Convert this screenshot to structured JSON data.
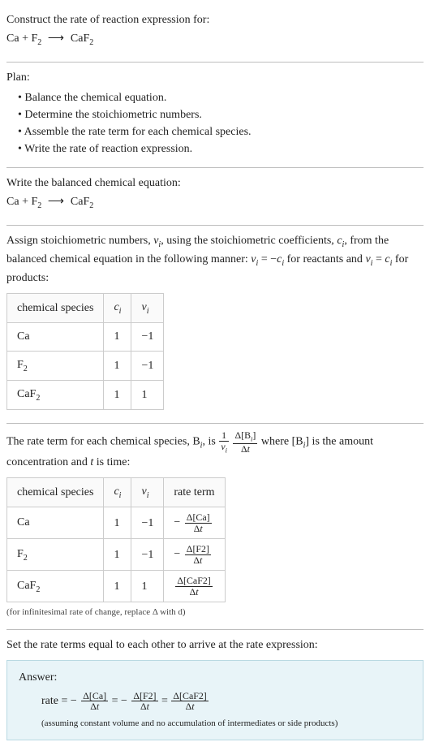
{
  "intro": {
    "prompt": "Construct the rate of reaction expression for:"
  },
  "equation": {
    "r1": "Ca",
    "plus": " + ",
    "r2a": "F",
    "r2s": "2",
    "arrow": "⟶",
    "p1a": "CaF",
    "p1s": "2"
  },
  "plan": {
    "heading": "Plan:",
    "items": [
      "Balance the chemical equation.",
      "Determine the stoichiometric numbers.",
      "Assemble the rate term for each chemical species.",
      "Write the rate of reaction expression."
    ]
  },
  "balanced_heading": "Write the balanced chemical equation:",
  "stoich_text": {
    "p1": "Assign stoichiometric numbers, ",
    "nu": "ν",
    "i": "i",
    "p2": ", using the stoichiometric coefficients, ",
    "c": "c",
    "p3": ", from the balanced chemical equation in the following manner: ",
    "eq1a": "ν",
    "eq1b": " = −",
    "eq1c": "c",
    "p4": " for reactants and ",
    "eq2a": "ν",
    "eq2b": " = ",
    "eq2c": "c",
    "p5": " for products:"
  },
  "table1": {
    "h1": "chemical species",
    "h2c": "c",
    "h2i": "i",
    "h3n": "ν",
    "h3i": "i",
    "rows": [
      {
        "species_a": "Ca",
        "species_s": "",
        "c": "1",
        "v": "−1"
      },
      {
        "species_a": "F",
        "species_s": "2",
        "c": "1",
        "v": "−1"
      },
      {
        "species_a": "CaF",
        "species_s": "2",
        "c": "1",
        "v": "1"
      }
    ]
  },
  "rate_intro": {
    "p1": "The rate term for each chemical species, ",
    "B": "B",
    "i": "i",
    "p2": ", is ",
    "one": "1",
    "nu": "ν",
    "dB": "Δ[B",
    "dBend": "]",
    "dt": "Δt",
    "p3": " where [B",
    "p4": "] is the amount concentration and ",
    "t": "t",
    "p5": " is time:"
  },
  "table2": {
    "h1": "chemical species",
    "h2c": "c",
    "h2i": "i",
    "h3n": "ν",
    "h3i": "i",
    "h4": "rate term",
    "rows": [
      {
        "species_a": "Ca",
        "species_s": "",
        "c": "1",
        "v": "−1",
        "neg": "− ",
        "num": "Δ[Ca]",
        "den": "Δt"
      },
      {
        "species_a": "F",
        "species_s": "2",
        "c": "1",
        "v": "−1",
        "neg": "− ",
        "num": "Δ[F2]",
        "den": "Δt"
      },
      {
        "species_a": "CaF",
        "species_s": "2",
        "c": "1",
        "v": "1",
        "neg": "",
        "num": "Δ[CaF2]",
        "den": "Δt"
      }
    ]
  },
  "footnote": "(for infinitesimal rate of change, replace Δ with d)",
  "set_equal": "Set the rate terms equal to each other to arrive at the rate expression:",
  "answer": {
    "label": "Answer:",
    "rate": "rate = ",
    "neg": "− ",
    "n1": "Δ[Ca]",
    "d1": "Δt",
    "eq": " = ",
    "n2": "Δ[F2]",
    "d2": "Δt",
    "n3": "Δ[CaF2]",
    "d3": "Δt",
    "assumption": "(assuming constant volume and no accumulation of intermediates or side products)"
  }
}
